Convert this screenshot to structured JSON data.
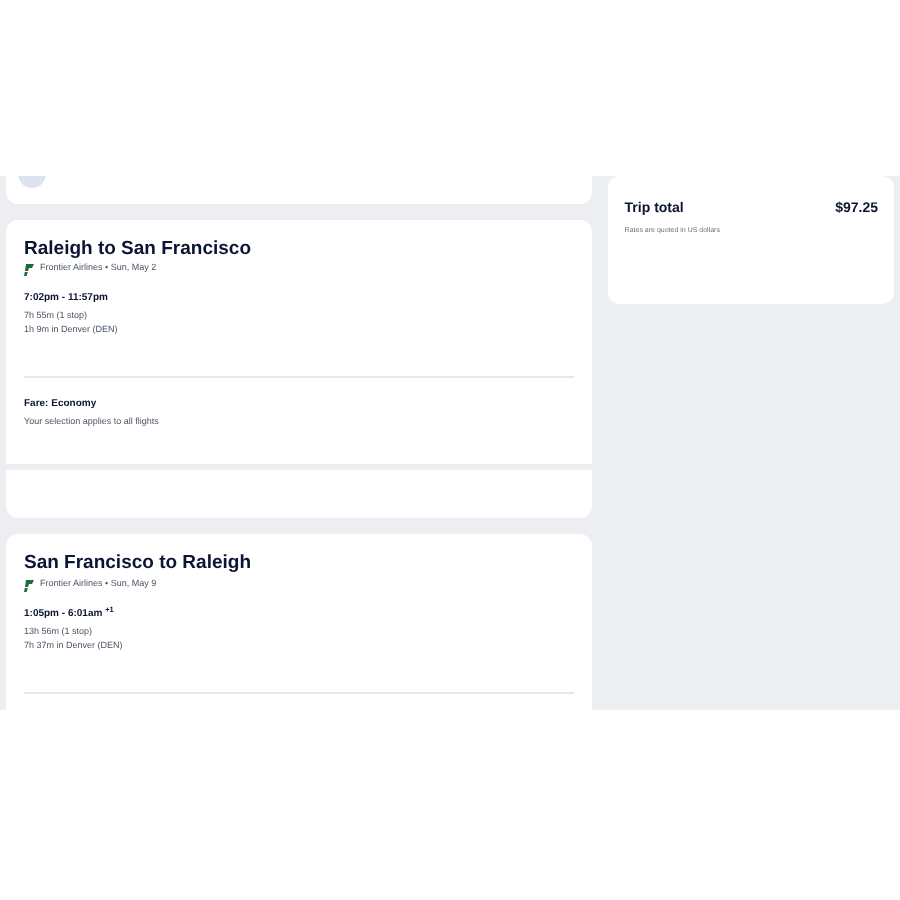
{
  "flights": [
    {
      "title": "Raleigh to San Francisco",
      "airline": "Frontier Airlines • Sun, May 2",
      "times": "7:02pm - 11:57pm",
      "duration": "7h 55m (1 stop)",
      "layover": "1h 9m in Denver (DEN)",
      "fare_title": "Fare: Economy",
      "fare_note": "Your selection applies to all flights"
    },
    {
      "title": "San Francisco to Raleigh",
      "airline": "Frontier Airlines • Sun, May 9",
      "times": "1:05pm - 6:01am $^{+1}$",
      "duration": "13h 56m (1 stop)",
      "layover": "7h 37m in Denver (DEN)"
    }
  ],
  "summary": {
    "label": "Trip total",
    "amount": "$97.25",
    "note": "Rates are quoted in US dollars"
  }
}
